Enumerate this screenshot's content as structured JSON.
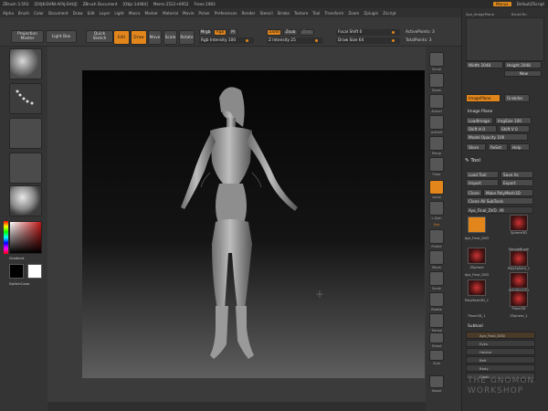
{
  "titlebar": {
    "app": "ZBrush 3.5R3",
    "doc_id": "[DXJK-DHNI-AFAJ-EHUJ]",
    "doc": "ZBrush Document",
    "obj": "[Objs:14484]",
    "mem": "Mems:2522+6952",
    "free": "Frees:1983",
    "menus_btn": "Menus",
    "script": "DefaultZScript"
  },
  "menubar": [
    "Alpha",
    "Brush",
    "Color",
    "Document",
    "Draw",
    "Edit",
    "Layer",
    "Light",
    "Macro",
    "Marker",
    "Material",
    "Movie",
    "Picker",
    "Preferences",
    "Render",
    "Stencil",
    "Stroke",
    "Texture",
    "Tool",
    "Transform",
    "Zoom",
    "Zplugin",
    "Zscript"
  ],
  "toolbar": {
    "projection_master": "Projection Master",
    "lightbox": "Light Box",
    "quick_sketch": "Quick Sketch",
    "edit": "Edit",
    "draw": "Draw",
    "move": "Move",
    "scale": "Scale",
    "rotate": "Rotate",
    "mrgb": "Mrgb",
    "rgb": "Rgb",
    "m": "M",
    "rgb_intensity": "Rgb Intensity 100",
    "zadd": "Zadd",
    "zsub": "Zsub",
    "zcut": "Zcut",
    "z_intensity": "Z Intensity 25",
    "focal_shift": "Focal Shift 0",
    "draw_size": "Draw Size 64",
    "active_points": "ActivePoints: 3",
    "total_points": "TotalPoints: 3"
  },
  "leftshelf": {
    "gradient": "Gradient",
    "switch_color": "SwitchColor"
  },
  "rightshelf": [
    "Scroll",
    "Zoom",
    "Actual",
    "AAHalf",
    "Persp",
    "Floor",
    "Local",
    "L.Sym",
    "Xyz",
    "Frame",
    "Move",
    "Scale",
    "Rotate",
    "Transp",
    "Ghost",
    "Solo",
    "Xpose"
  ],
  "tray": {
    "top_labels": [
      "Aya_ImagePlane",
      "BrushTrn"
    ],
    "width": "Width 2048",
    "height": "Height 2048",
    "new_doc": "New",
    "image_plane_btn": "ImagePlane",
    "grabdoc": "Grabdoc",
    "image_plane_title": "Image Plane",
    "load_image": "LoadImage",
    "img_size": "ImgSize 100",
    "shift_h": "Shift H 0",
    "shift_v": "Shift V 0",
    "model_opacity": "Model Opacity 100",
    "store": "Store",
    "reset": "ReSet",
    "help": "Help",
    "tool_title": "Tool",
    "load_tool": "Load Tool",
    "save_as": "Save As",
    "import": "Import",
    "export": "Export",
    "clone": "Clone",
    "make_polymesh": "Make PolyMesh3D",
    "clone_all": "Clone All SubTools",
    "current_tool": "Aya_Final_DVD. 49",
    "tools": [
      {
        "name": "Aya_Final_DVD"
      },
      {
        "name": "Sphere3D"
      },
      {
        "name": "SimpleBrush"
      },
      {
        "name": "ZSphere"
      },
      {
        "name": "PolySphere_1"
      },
      {
        "name": "Aya_Final_DVD"
      },
      {
        "name": "PolyMesh3D"
      },
      {
        "name": "PolyMesh3D_1"
      },
      {
        "name": "Plane3D"
      },
      {
        "name": "Plane3D_1"
      },
      {
        "name": "ZSphere_1"
      }
    ],
    "subtool_title": "Subtool",
    "subtools": [
      "Aya_Final_DVD",
      "Eyes",
      "Holster",
      "Belt",
      "Body",
      "Cloak"
    ]
  },
  "watermark": "THE GNOMON WORKSHOP"
}
